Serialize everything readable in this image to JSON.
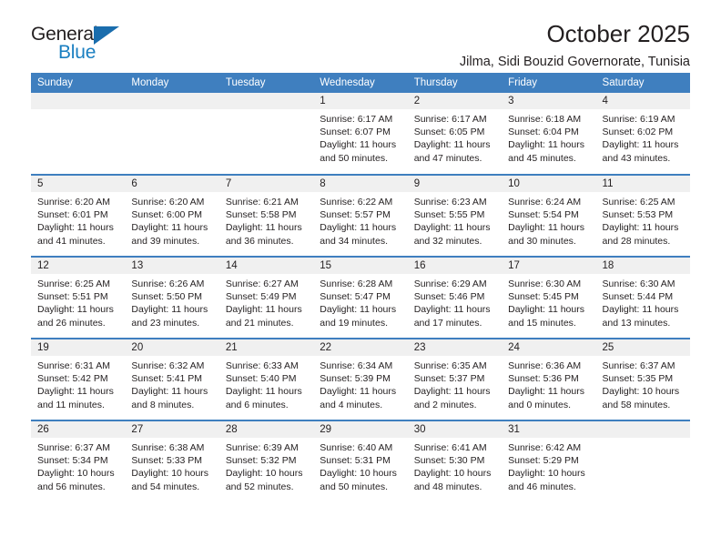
{
  "brand": {
    "name_top": "General",
    "name_bottom": "Blue",
    "triangle_color": "#1a6dad",
    "blue_color": "#1a7fc1"
  },
  "header": {
    "title": "October 2025",
    "subtitle": "Jilma, Sidi Bouzid Governorate, Tunisia"
  },
  "theme": {
    "header_bar": "#3f7fbf",
    "day_band": "#f0f0f0",
    "text": "#231f20"
  },
  "calendar": {
    "weekday_headers": [
      "Sunday",
      "Monday",
      "Tuesday",
      "Wednesday",
      "Thursday",
      "Friday",
      "Saturday"
    ],
    "weeks": [
      [
        {
          "day": "",
          "lines": []
        },
        {
          "day": "",
          "lines": []
        },
        {
          "day": "",
          "lines": []
        },
        {
          "day": "1",
          "lines": [
            "Sunrise: 6:17 AM",
            "Sunset: 6:07 PM",
            "Daylight: 11 hours",
            "and 50 minutes."
          ]
        },
        {
          "day": "2",
          "lines": [
            "Sunrise: 6:17 AM",
            "Sunset: 6:05 PM",
            "Daylight: 11 hours",
            "and 47 minutes."
          ]
        },
        {
          "day": "3",
          "lines": [
            "Sunrise: 6:18 AM",
            "Sunset: 6:04 PM",
            "Daylight: 11 hours",
            "and 45 minutes."
          ]
        },
        {
          "day": "4",
          "lines": [
            "Sunrise: 6:19 AM",
            "Sunset: 6:02 PM",
            "Daylight: 11 hours",
            "and 43 minutes."
          ]
        }
      ],
      [
        {
          "day": "5",
          "lines": [
            "Sunrise: 6:20 AM",
            "Sunset: 6:01 PM",
            "Daylight: 11 hours",
            "and 41 minutes."
          ]
        },
        {
          "day": "6",
          "lines": [
            "Sunrise: 6:20 AM",
            "Sunset: 6:00 PM",
            "Daylight: 11 hours",
            "and 39 minutes."
          ]
        },
        {
          "day": "7",
          "lines": [
            "Sunrise: 6:21 AM",
            "Sunset: 5:58 PM",
            "Daylight: 11 hours",
            "and 36 minutes."
          ]
        },
        {
          "day": "8",
          "lines": [
            "Sunrise: 6:22 AM",
            "Sunset: 5:57 PM",
            "Daylight: 11 hours",
            "and 34 minutes."
          ]
        },
        {
          "day": "9",
          "lines": [
            "Sunrise: 6:23 AM",
            "Sunset: 5:55 PM",
            "Daylight: 11 hours",
            "and 32 minutes."
          ]
        },
        {
          "day": "10",
          "lines": [
            "Sunrise: 6:24 AM",
            "Sunset: 5:54 PM",
            "Daylight: 11 hours",
            "and 30 minutes."
          ]
        },
        {
          "day": "11",
          "lines": [
            "Sunrise: 6:25 AM",
            "Sunset: 5:53 PM",
            "Daylight: 11 hours",
            "and 28 minutes."
          ]
        }
      ],
      [
        {
          "day": "12",
          "lines": [
            "Sunrise: 6:25 AM",
            "Sunset: 5:51 PM",
            "Daylight: 11 hours",
            "and 26 minutes."
          ]
        },
        {
          "day": "13",
          "lines": [
            "Sunrise: 6:26 AM",
            "Sunset: 5:50 PM",
            "Daylight: 11 hours",
            "and 23 minutes."
          ]
        },
        {
          "day": "14",
          "lines": [
            "Sunrise: 6:27 AM",
            "Sunset: 5:49 PM",
            "Daylight: 11 hours",
            "and 21 minutes."
          ]
        },
        {
          "day": "15",
          "lines": [
            "Sunrise: 6:28 AM",
            "Sunset: 5:47 PM",
            "Daylight: 11 hours",
            "and 19 minutes."
          ]
        },
        {
          "day": "16",
          "lines": [
            "Sunrise: 6:29 AM",
            "Sunset: 5:46 PM",
            "Daylight: 11 hours",
            "and 17 minutes."
          ]
        },
        {
          "day": "17",
          "lines": [
            "Sunrise: 6:30 AM",
            "Sunset: 5:45 PM",
            "Daylight: 11 hours",
            "and 15 minutes."
          ]
        },
        {
          "day": "18",
          "lines": [
            "Sunrise: 6:30 AM",
            "Sunset: 5:44 PM",
            "Daylight: 11 hours",
            "and 13 minutes."
          ]
        }
      ],
      [
        {
          "day": "19",
          "lines": [
            "Sunrise: 6:31 AM",
            "Sunset: 5:42 PM",
            "Daylight: 11 hours",
            "and 11 minutes."
          ]
        },
        {
          "day": "20",
          "lines": [
            "Sunrise: 6:32 AM",
            "Sunset: 5:41 PM",
            "Daylight: 11 hours",
            "and 8 minutes."
          ]
        },
        {
          "day": "21",
          "lines": [
            "Sunrise: 6:33 AM",
            "Sunset: 5:40 PM",
            "Daylight: 11 hours",
            "and 6 minutes."
          ]
        },
        {
          "day": "22",
          "lines": [
            "Sunrise: 6:34 AM",
            "Sunset: 5:39 PM",
            "Daylight: 11 hours",
            "and 4 minutes."
          ]
        },
        {
          "day": "23",
          "lines": [
            "Sunrise: 6:35 AM",
            "Sunset: 5:37 PM",
            "Daylight: 11 hours",
            "and 2 minutes."
          ]
        },
        {
          "day": "24",
          "lines": [
            "Sunrise: 6:36 AM",
            "Sunset: 5:36 PM",
            "Daylight: 11 hours",
            "and 0 minutes."
          ]
        },
        {
          "day": "25",
          "lines": [
            "Sunrise: 6:37 AM",
            "Sunset: 5:35 PM",
            "Daylight: 10 hours",
            "and 58 minutes."
          ]
        }
      ],
      [
        {
          "day": "26",
          "lines": [
            "Sunrise: 6:37 AM",
            "Sunset: 5:34 PM",
            "Daylight: 10 hours",
            "and 56 minutes."
          ]
        },
        {
          "day": "27",
          "lines": [
            "Sunrise: 6:38 AM",
            "Sunset: 5:33 PM",
            "Daylight: 10 hours",
            "and 54 minutes."
          ]
        },
        {
          "day": "28",
          "lines": [
            "Sunrise: 6:39 AM",
            "Sunset: 5:32 PM",
            "Daylight: 10 hours",
            "and 52 minutes."
          ]
        },
        {
          "day": "29",
          "lines": [
            "Sunrise: 6:40 AM",
            "Sunset: 5:31 PM",
            "Daylight: 10 hours",
            "and 50 minutes."
          ]
        },
        {
          "day": "30",
          "lines": [
            "Sunrise: 6:41 AM",
            "Sunset: 5:30 PM",
            "Daylight: 10 hours",
            "and 48 minutes."
          ]
        },
        {
          "day": "31",
          "lines": [
            "Sunrise: 6:42 AM",
            "Sunset: 5:29 PM",
            "Daylight: 10 hours",
            "and 46 minutes."
          ]
        },
        {
          "day": "",
          "lines": []
        }
      ]
    ]
  }
}
